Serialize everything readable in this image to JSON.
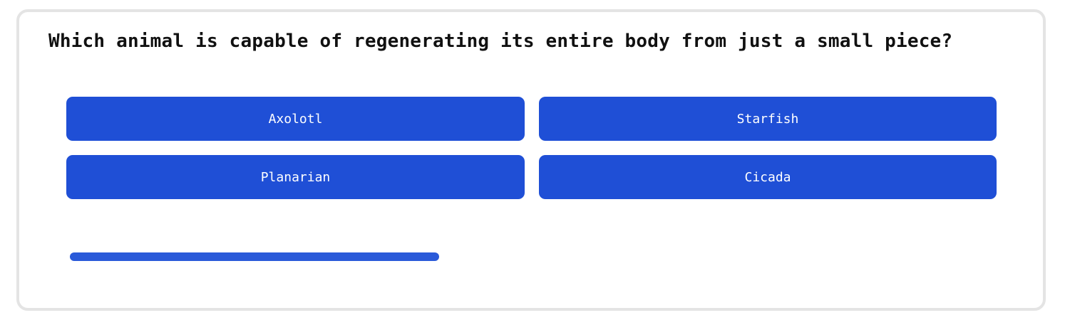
{
  "quiz": {
    "question": "Which animal is capable of regenerating its entire body from just a small piece?",
    "answers": [
      {
        "label": "Axolotl"
      },
      {
        "label": "Starfish"
      },
      {
        "label": "Planarian"
      },
      {
        "label": "Cicada"
      }
    ],
    "progress_fraction": 0.4
  },
  "colors": {
    "accent": "#1f4fd6",
    "progress": "#2a5ad9",
    "card_border": "#e4e4e4"
  }
}
